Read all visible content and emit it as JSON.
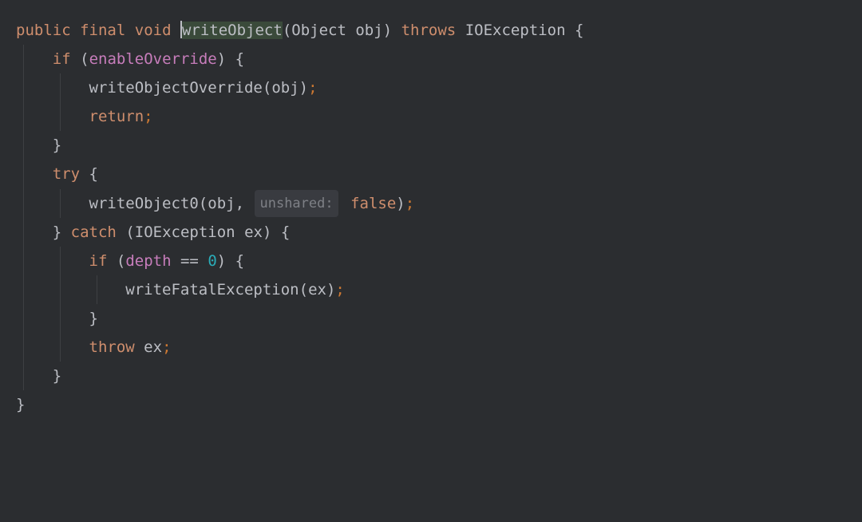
{
  "code": {
    "l1": {
      "kw_public": "public",
      "kw_final": "final",
      "kw_void": "void",
      "method": "writeObject",
      "paren_open": "(",
      "type": "Object",
      "param": "obj",
      "paren_close": ")",
      "kw_throws": "throws",
      "exception": "IOException",
      "brace": "{"
    },
    "l2": {
      "kw_if": "if",
      "paren_open": "(",
      "field": "enableOverride",
      "paren_close": ")",
      "brace": "{"
    },
    "l3": {
      "call": "writeObjectOverride",
      "paren_open": "(",
      "arg": "obj",
      "paren_close": ")",
      "semi": ";"
    },
    "l4": {
      "kw_return": "return",
      "semi": ";"
    },
    "l5": {
      "brace": "}"
    },
    "l6": {
      "kw_try": "try",
      "brace": "{"
    },
    "l7": {
      "call": "writeObject0",
      "paren_open": "(",
      "arg": "obj",
      "comma": ",",
      "hint": "unshared:",
      "bool": "false",
      "paren_close": ")",
      "semi": ";"
    },
    "l8": {
      "brace_close": "}",
      "kw_catch": "catch",
      "paren_open": "(",
      "type": "IOException",
      "var": "ex",
      "paren_close": ")",
      "brace_open": "{"
    },
    "l9": {
      "kw_if": "if",
      "paren_open": "(",
      "field": "depth",
      "op": "==",
      "num": "0",
      "paren_close": ")",
      "brace": "{"
    },
    "l10": {
      "call": "writeFatalException",
      "paren_open": "(",
      "arg": "ex",
      "paren_close": ")",
      "semi": ";"
    },
    "l11": {
      "brace": "}"
    },
    "l12": {
      "kw_throw": "throw",
      "var": "ex",
      "semi": ";"
    },
    "l13": {
      "brace": "}"
    },
    "l14": {
      "brace": "}"
    }
  }
}
